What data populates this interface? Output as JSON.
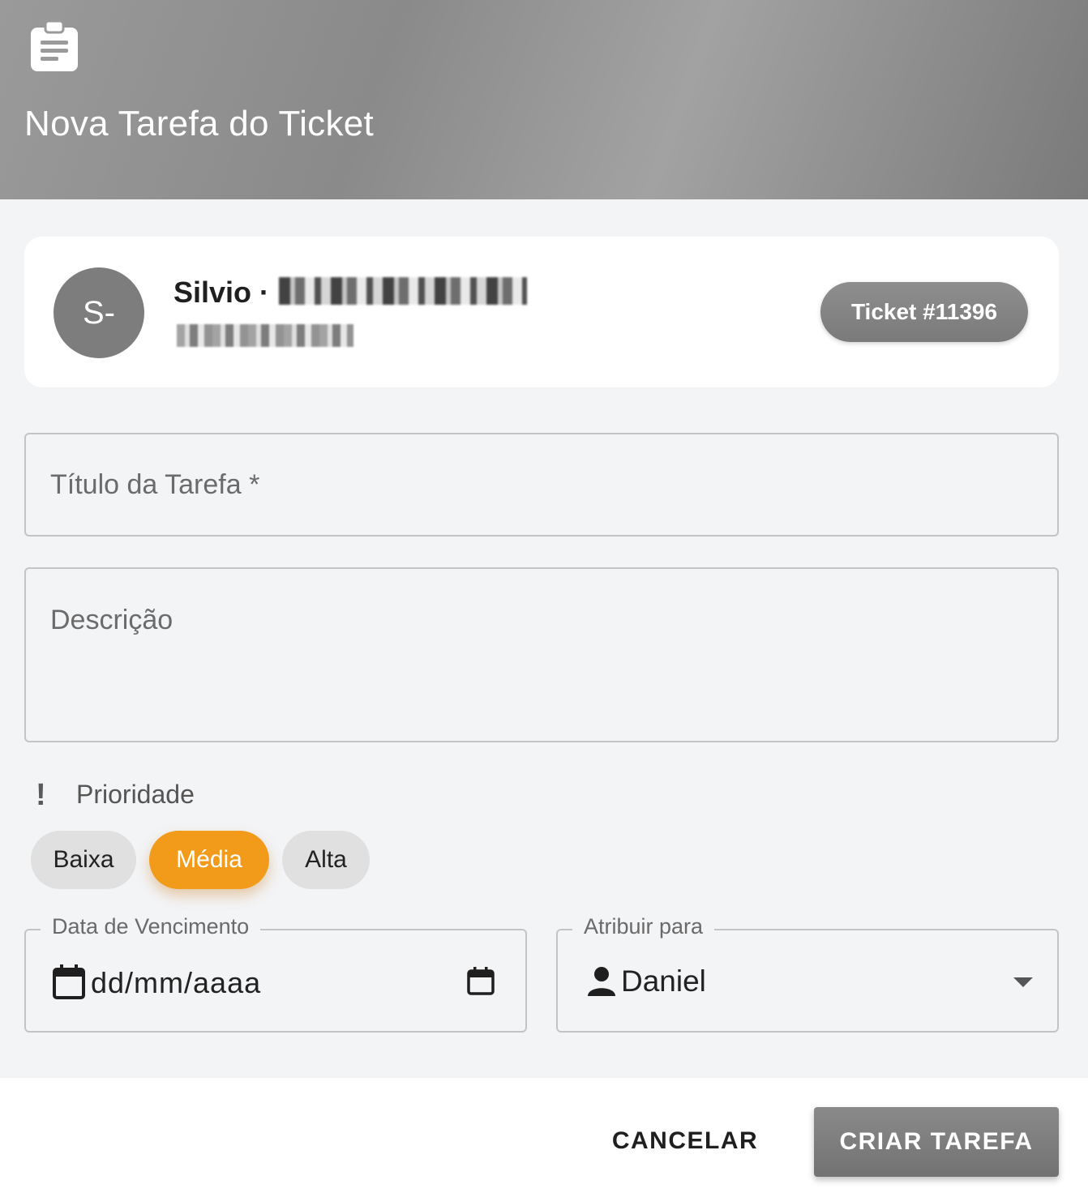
{
  "header": {
    "icon": "clipboard-icon",
    "title": "Nova Tarefa do Ticket"
  },
  "contact": {
    "avatar_initials": "S-",
    "name": "Silvio ·",
    "name_redacted": true,
    "phone_redacted": true,
    "ticket_label": "Ticket #11396"
  },
  "form": {
    "title_placeholder": "Título da Tarefa *",
    "title_value": "",
    "description_placeholder": "Descrição",
    "description_value": "",
    "priority": {
      "icon": "exclamation-icon",
      "label": "Prioridade",
      "options": [
        "Baixa",
        "Média",
        "Alta"
      ],
      "selected": "Média",
      "selected_color": "#f29b1a"
    },
    "due_date": {
      "label": "Data de Vencimento",
      "placeholder": "dd/mm/aaaa",
      "icon": "calendar-icon"
    },
    "assign": {
      "label": "Atribuir para",
      "icon": "person-icon",
      "selected": "Daniel"
    }
  },
  "footer": {
    "cancel_label": "CANCELAR",
    "create_label": "CRIAR TAREFA"
  }
}
